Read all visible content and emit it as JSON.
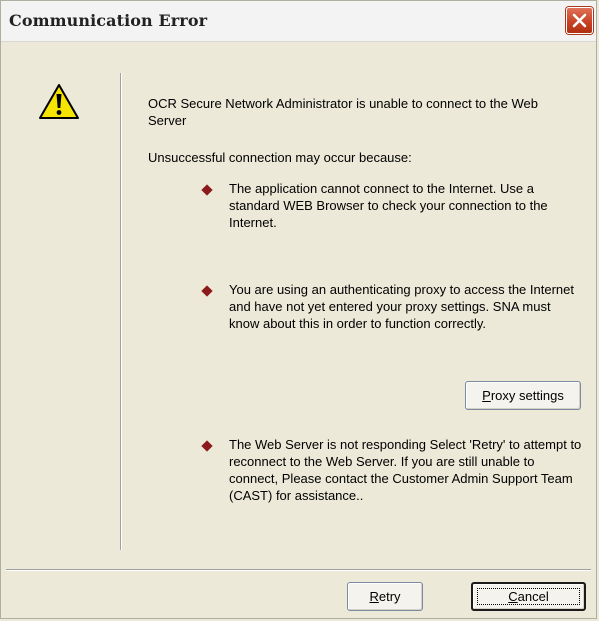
{
  "window": {
    "title": "Communication Error"
  },
  "message": {
    "main": "OCR Secure Network Administrator is unable to connect to the Web Server",
    "cause_intro": "Unsuccessful connection may occur because:"
  },
  "reasons": [
    "The application cannot connect to the Internet. Use a standard WEB Browser to check your connection to the Internet.",
    "You are using an authenticating proxy to access the Internet and have not yet entered your proxy settings. SNA must know about this in order to function correctly.",
    "The Web Server is not responding Select 'Retry' to attempt to reconnect to the Web Server. If you are still unable to connect, Please contact the Customer Admin Support Team (CAST) for assistance.."
  ],
  "buttons": {
    "proxy_settings": {
      "mnemonic": "P",
      "rest": "roxy settings"
    },
    "retry": {
      "mnemonic": "R",
      "rest": "etry"
    },
    "cancel": {
      "mnemonic": "C",
      "rest": "ancel"
    }
  },
  "icons": {
    "warning": "warning-triangle-icon",
    "close": "close-icon"
  },
  "colors": {
    "dialog_background": "#ece9d8",
    "close_button": "#c84324",
    "bullet": "#8b1a1a",
    "warning_yellow": "#f5e400"
  }
}
